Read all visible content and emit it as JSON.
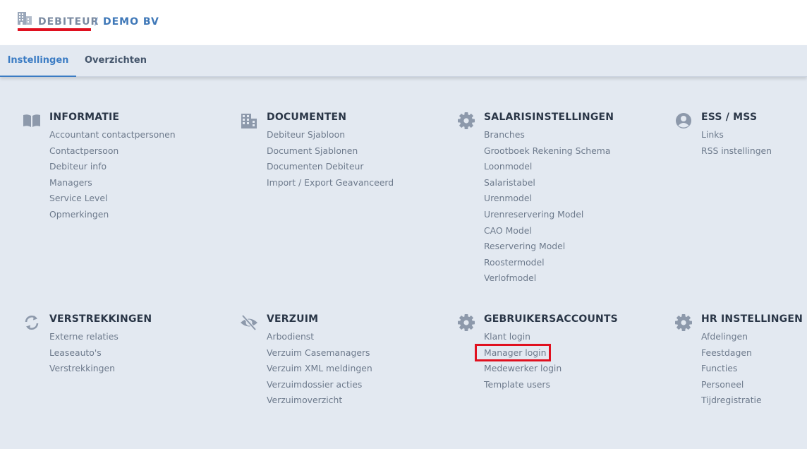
{
  "header": {
    "debiteur": "DEBITEUR",
    "separator": "/",
    "company": "DEMO BV",
    "brand_icon": "building-icon",
    "accent_color": "#e0101f"
  },
  "tabs": [
    {
      "label": "Instellingen",
      "active": true
    },
    {
      "label": "Overzichten",
      "active": false
    }
  ],
  "sections": {
    "informatie": {
      "title": "INFORMATIE",
      "icon": "book-icon",
      "items": [
        "Accountant contactpersonen",
        "Contactpersoon",
        "Debiteur info",
        "Managers",
        "Service Level",
        "Opmerkingen"
      ]
    },
    "documenten": {
      "title": "DOCUMENTEN",
      "icon": "building-icon",
      "items": [
        "Debiteur Sjabloon",
        "Document Sjablonen",
        "Documenten Debiteur",
        "Import / Export Geavanceerd"
      ]
    },
    "salarisinstellingen": {
      "title": "SALARISINSTELLINGEN",
      "icon": "gear-icon",
      "items": [
        "Branches",
        "Grootboek Rekening Schema",
        "Loonmodel",
        "Salaristabel",
        "Urenmodel",
        "Urenreservering Model",
        "CAO Model",
        "Reservering Model",
        "Roostermodel",
        "Verlofmodel"
      ]
    },
    "ess_mss": {
      "title": "ESS / MSS",
      "icon": "user-circle-icon",
      "items": [
        "Links",
        "RSS instellingen"
      ]
    },
    "verstrekkingen": {
      "title": "VERSTREKKINGEN",
      "icon": "sync-icon",
      "items": [
        "Externe relaties",
        "Leaseauto's",
        "Verstrekkingen"
      ]
    },
    "verzuim": {
      "title": "VERZUIM",
      "icon": "eye-slash-icon",
      "items": [
        "Arbodienst",
        "Verzuim Casemanagers",
        "Verzuim XML meldingen",
        "Verzuimdossier acties",
        "Verzuimoverzicht"
      ]
    },
    "gebruikersaccounts": {
      "title": "GEBRUIKERSACCOUNTS",
      "icon": "gear-icon",
      "items": [
        "Klant login",
        "Manager login",
        "Medewerker login",
        "Template users"
      ]
    },
    "hr_instellingen": {
      "title": "HR INSTELLINGEN",
      "icon": "gear-icon",
      "items": [
        "Afdelingen",
        "Feestdagen",
        "Functies",
        "Personeel",
        "Tijdregistratie"
      ]
    }
  }
}
